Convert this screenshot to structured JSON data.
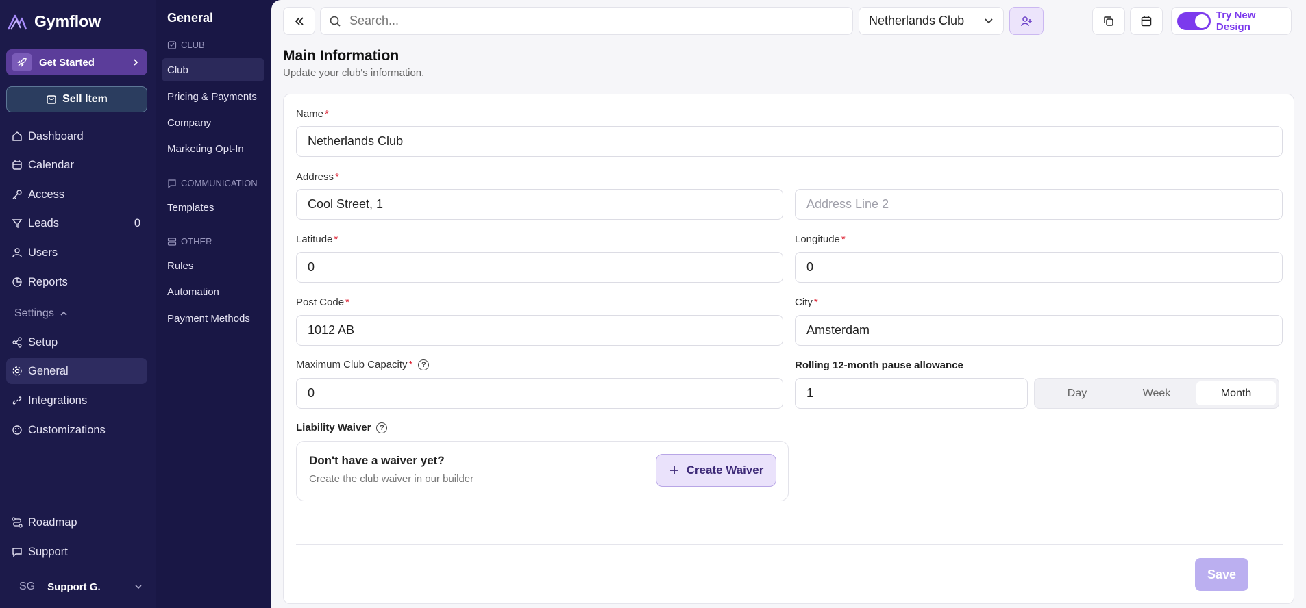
{
  "app": {
    "name": "Gymflow"
  },
  "nav": {
    "get_started": "Get Started",
    "sell_item": "Sell Item",
    "items": [
      {
        "label": "Dashboard",
        "icon": "home-icon"
      },
      {
        "label": "Calendar",
        "icon": "calendar-icon"
      },
      {
        "label": "Access",
        "icon": "key-icon"
      },
      {
        "label": "Leads",
        "icon": "filter-icon",
        "count": "0"
      },
      {
        "label": "Users",
        "icon": "user-icon"
      },
      {
        "label": "Reports",
        "icon": "pie-chart-icon"
      }
    ],
    "settings_label": "Settings",
    "settings_items": [
      {
        "label": "Setup",
        "icon": "setup-icon"
      },
      {
        "label": "General",
        "icon": "gear-icon",
        "active": true
      },
      {
        "label": "Integrations",
        "icon": "link-icon"
      },
      {
        "label": "Customizations",
        "icon": "palette-icon"
      }
    ],
    "roadmap": "Roadmap",
    "support": "Support",
    "user": {
      "initials": "SG",
      "name": "Support G."
    }
  },
  "subnav": {
    "title": "General",
    "sections": [
      {
        "label": "CLUB",
        "items": [
          "Club",
          "Pricing & Payments",
          "Company",
          "Marketing Opt-In"
        ]
      },
      {
        "label": "COMMUNICATION",
        "items": [
          "Templates"
        ]
      },
      {
        "label": "OTHER",
        "items": [
          "Rules",
          "Automation",
          "Payment Methods"
        ]
      }
    ],
    "active": "Club"
  },
  "topbar": {
    "search_placeholder": "Search...",
    "club": "Netherlands Club",
    "try_new_design": "Try New Design"
  },
  "page": {
    "title": "Main Information",
    "subtitle": "Update your club's information."
  },
  "form": {
    "name_label": "Name",
    "name_value": "Netherlands Club",
    "address_label": "Address",
    "address_value": "Cool Street, 1",
    "address2_placeholder": "Address Line 2",
    "latitude_label": "Latitude",
    "latitude_value": "0",
    "longitude_label": "Longitude",
    "longitude_value": "0",
    "postcode_label": "Post Code",
    "postcode_value": "1012 AB",
    "city_label": "City",
    "city_value": "Amsterdam",
    "capacity_label": "Maximum Club Capacity",
    "capacity_value": "0",
    "pause_label": "Rolling 12-month pause allowance",
    "pause_value": "1",
    "pause_units": [
      "Day",
      "Week",
      "Month"
    ],
    "pause_selected": "Month",
    "waiver_label": "Liability Waiver",
    "waiver_title": "Don't have a waiver yet?",
    "waiver_sub": "Create the club waiver in our builder",
    "create_waiver": "Create Waiver",
    "save": "Save",
    "required_mark": "*",
    "help_mark": "?"
  },
  "colors": {
    "accent": "#7c3aed",
    "nav_bg": "#1c1a4a"
  }
}
